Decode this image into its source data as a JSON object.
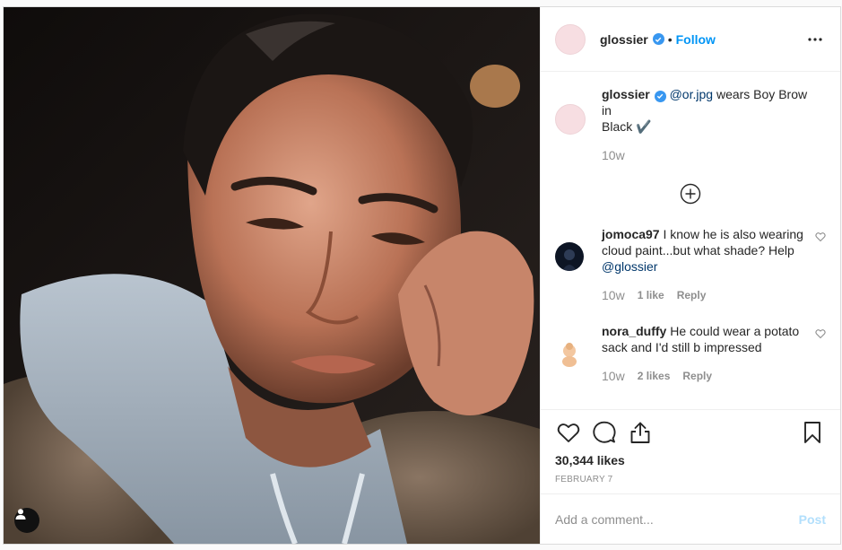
{
  "post": {
    "author": "glossier",
    "follow_label": "Follow",
    "separator": "•",
    "photo_description_icon": "user-tag-icon"
  },
  "caption": {
    "username": "glossier",
    "mention": "@or.jpg",
    "text_line1": " wears Boy Brow in",
    "text_line2": "Black",
    "check": "✔️",
    "time": "10w"
  },
  "comments": [
    {
      "username": "jomoca97",
      "text": " I know he is also wearing cloud paint...but what shade? Help ",
      "mention": "@glossier",
      "time": "10w",
      "likes": "1 like",
      "reply": "Reply"
    },
    {
      "username": "nora_duffy",
      "text": " He could wear a potato sack and I'd still b impressed",
      "mention": "",
      "time": "10w",
      "likes": "2 likes",
      "reply": "Reply"
    }
  ],
  "actions": {
    "likes": "30,344 likes",
    "date": "FEBRUARY 7"
  },
  "add_comment": {
    "placeholder": "Add a comment...",
    "post_label": "Post"
  },
  "colors": {
    "accent": "#0095f6",
    "verified": "#3897f0",
    "post_disabled": "#b2dffc",
    "brand_avatar": "#f7dee2"
  }
}
